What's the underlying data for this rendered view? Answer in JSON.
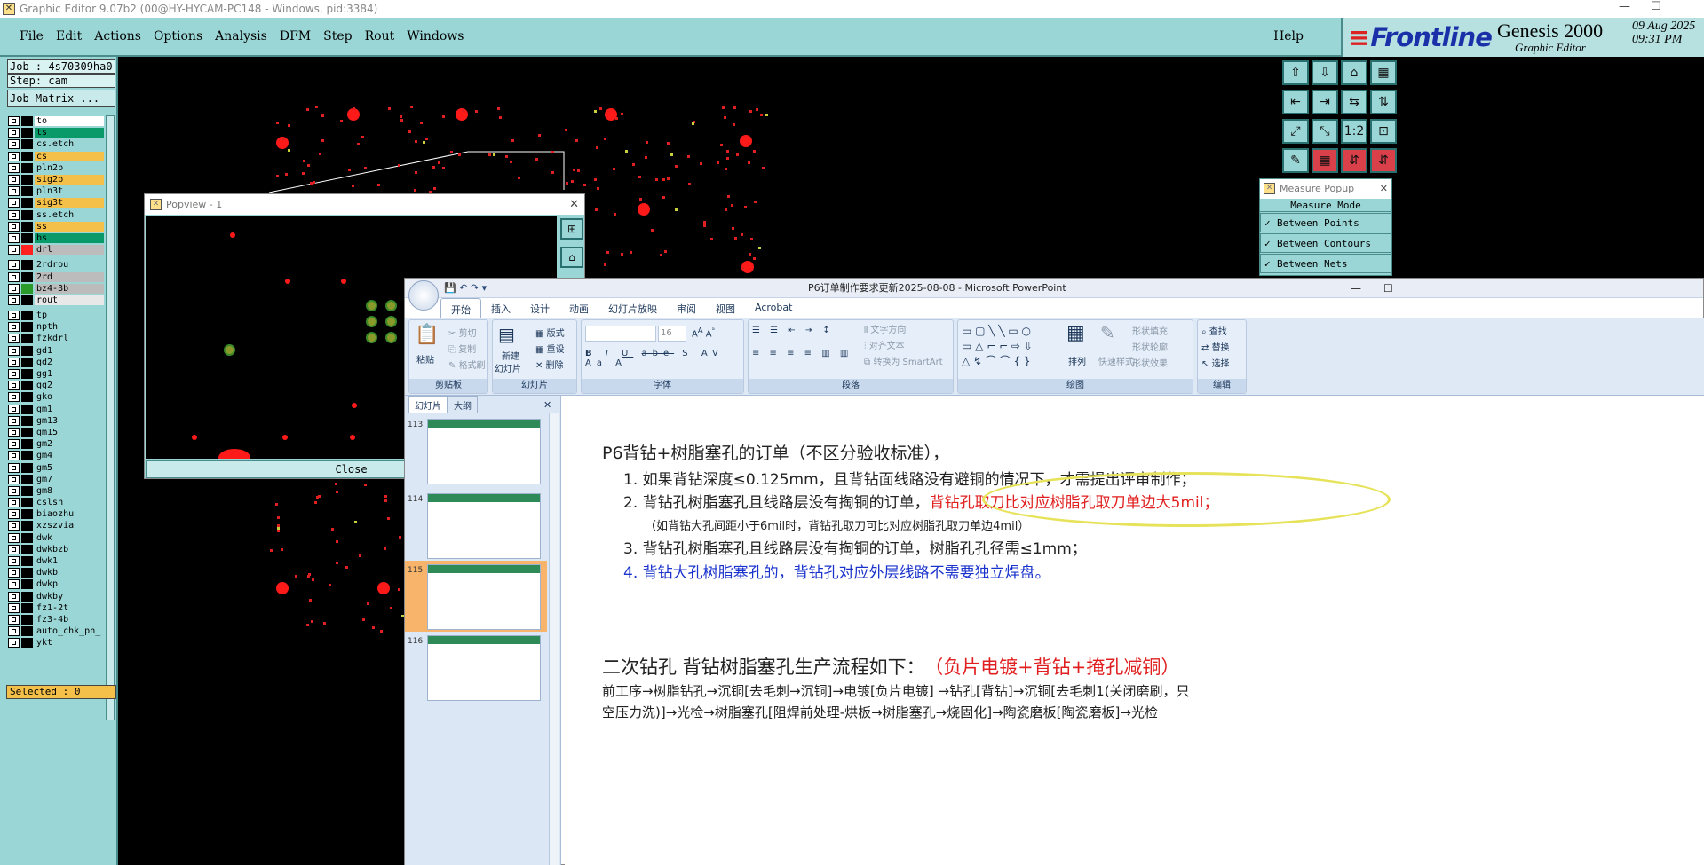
{
  "genesis": {
    "title": "Graphic Editor 9.07b2 (00@HY-HYCAM-PC148 - Windows, pid:3384)",
    "menu": [
      "File",
      "Edit",
      "Actions",
      "Options",
      "Analysis",
      "DFM",
      "Step",
      "Rout",
      "Windows"
    ],
    "help": "Help",
    "brand": {
      "logo": "Frontline",
      "product": "Genesis 2000",
      "sub": "Graphic Editor",
      "date": "09 Aug 2025",
      "time": "09:31 PM"
    },
    "job": "Job : 4s70309ha0",
    "step": "Step: cam",
    "job_matrix": "Job Matrix ...",
    "layers": [
      {
        "name": "to",
        "color": "#ffffff"
      },
      {
        "name": "ts",
        "color": "#0a9a6a"
      },
      {
        "name": "cs.etch",
        "color": "#9bd6d6"
      },
      {
        "name": "cs",
        "color": "#f5c04a"
      },
      {
        "name": "pln2b",
        "color": "#9bd6d6"
      },
      {
        "name": "sig2b",
        "color": "#f5c04a"
      },
      {
        "name": "pln3t",
        "color": "#9bd6d6"
      },
      {
        "name": "sig3t",
        "color": "#f5c04a"
      },
      {
        "name": "ss.etch",
        "color": "#9bd6d6"
      },
      {
        "name": "ss",
        "color": "#f5c04a"
      },
      {
        "name": "bs",
        "color": "#0a9a6a"
      },
      {
        "name": "drl",
        "color": "#bcbcbc"
      },
      {
        "name": "2rdrou",
        "color": "#9bd6d6"
      },
      {
        "name": "2rd",
        "color": "#bcbcbc"
      },
      {
        "name": "bz4-3b",
        "color": "#bcbcbc"
      },
      {
        "name": "rout",
        "color": "#e8e8e8"
      },
      {
        "name": "tp",
        "color": "#9bd6d6"
      },
      {
        "name": "npth",
        "color": "#9bd6d6"
      },
      {
        "name": "fzkdrl",
        "color": "#9bd6d6"
      },
      {
        "name": "gd1",
        "color": "#9bd6d6"
      },
      {
        "name": "gd2",
        "color": "#9bd6d6"
      },
      {
        "name": "gg1",
        "color": "#9bd6d6"
      },
      {
        "name": "gg2",
        "color": "#9bd6d6"
      },
      {
        "name": "gko",
        "color": "#9bd6d6"
      },
      {
        "name": "gm1",
        "color": "#9bd6d6"
      },
      {
        "name": "gm13",
        "color": "#9bd6d6"
      },
      {
        "name": "gm15",
        "color": "#9bd6d6"
      },
      {
        "name": "gm2",
        "color": "#9bd6d6"
      },
      {
        "name": "gm4",
        "color": "#9bd6d6"
      },
      {
        "name": "gm5",
        "color": "#9bd6d6"
      },
      {
        "name": "gm7",
        "color": "#9bd6d6"
      },
      {
        "name": "gm8",
        "color": "#9bd6d6"
      },
      {
        "name": "cslsh",
        "color": "#9bd6d6"
      },
      {
        "name": "biaozhu",
        "color": "#9bd6d6"
      },
      {
        "name": "xzszvia",
        "color": "#9bd6d6"
      },
      {
        "name": "dwk",
        "color": "#9bd6d6"
      },
      {
        "name": "dwkbzb",
        "color": "#9bd6d6"
      },
      {
        "name": "dwk1",
        "color": "#9bd6d6"
      },
      {
        "name": "dwkb",
        "color": "#9bd6d6"
      },
      {
        "name": "dwkp",
        "color": "#9bd6d6"
      },
      {
        "name": "dwkby",
        "color": "#9bd6d6"
      },
      {
        "name": "fz1-2t",
        "color": "#9bd6d6"
      },
      {
        "name": "fz3-4b",
        "color": "#9bd6d6"
      },
      {
        "name": "auto_chk_pn_",
        "color": "#9bd6d6"
      },
      {
        "name": "ykt",
        "color": "#9bd6d6"
      }
    ],
    "selected": "Selected : 0",
    "measure": {
      "title": "Measure Popup",
      "header": "Measure Mode",
      "options": [
        "Between Points",
        "Between Contours",
        "Between Nets"
      ]
    },
    "popview": {
      "title": "Popview - 1",
      "close": "Close"
    }
  },
  "ppt": {
    "title": "P6订单制作要求更新2025-08-08 - Microsoft PowerPoint",
    "tabs": [
      "开始",
      "插入",
      "设计",
      "动画",
      "幻灯片放映",
      "审阅",
      "视图",
      "Acrobat"
    ],
    "groups": {
      "clipboard": {
        "label": "剪贴板",
        "paste": "粘贴",
        "cut": "剪切",
        "copy": "复制",
        "format": "格式刷"
      },
      "slides": {
        "label": "幻灯片",
        "new": "新建",
        "new2": "幻灯片",
        "layout": "版式",
        "reset": "重设",
        "delete": "删除"
      },
      "font": {
        "label": "字体",
        "size": "16"
      },
      "paragraph": {
        "label": "段落",
        "dir": "文字方向",
        "align": "对齐文本",
        "smart": "转换为 SmartArt"
      },
      "drawing": {
        "label": "绘图",
        "arrange": "排列",
        "quick": "快速样式",
        "fill": "形状填充",
        "outline": "形状轮廓",
        "effect": "形状效果"
      },
      "edit": {
        "label": "编辑",
        "find": "查找",
        "replace": "替换",
        "select": "选择"
      }
    },
    "pane_tabs": [
      "幻灯片",
      "大纲"
    ],
    "thumbs": [
      "113",
      "114",
      "115",
      "116"
    ],
    "slide": {
      "title1": "P6背钻+树脂塞孔的订单（不区分验收标准），",
      "item1": "1. 如果背钻深度≤0.125mm，且背钻面线路没有避铜的情况下，才需提出评审制作；",
      "item2a": "2. 背钻孔树脂塞孔且线路层没有掏铜的订单，",
      "item2b": "背钻孔取刀比对应树脂孔取刀单边大5mil；",
      "item2c": "（如背钻大孔间距小于6mil时，背钻孔取刀可比对应树脂孔取刀单边4mil）",
      "item3": "3. 背钻孔树脂塞孔且线路层没有掏铜的订单，树脂孔孔径需≤1mm；",
      "item4": "4. 背钻大孔树脂塞孔的，背钻孔对应外层线路不需要独立焊盘。",
      "title2a": "二次钻孔 背钻树脂塞孔生产流程如下：",
      "title2b": "（负片电镀+背钻+掩孔减铜）",
      "flow": "前工序→树脂钻孔→沉铜[去毛刺→沉铜]→电镀[负片电镀] →钻孔[背钻]→沉铜[去毛刺1(关闭磨刷，只",
      "flow2": "空压力洗)]→光检→树脂塞孔[阻焊前处理-烘板→树脂塞孔→烧固化]→陶瓷磨板[陶瓷磨板]→光检"
    }
  }
}
